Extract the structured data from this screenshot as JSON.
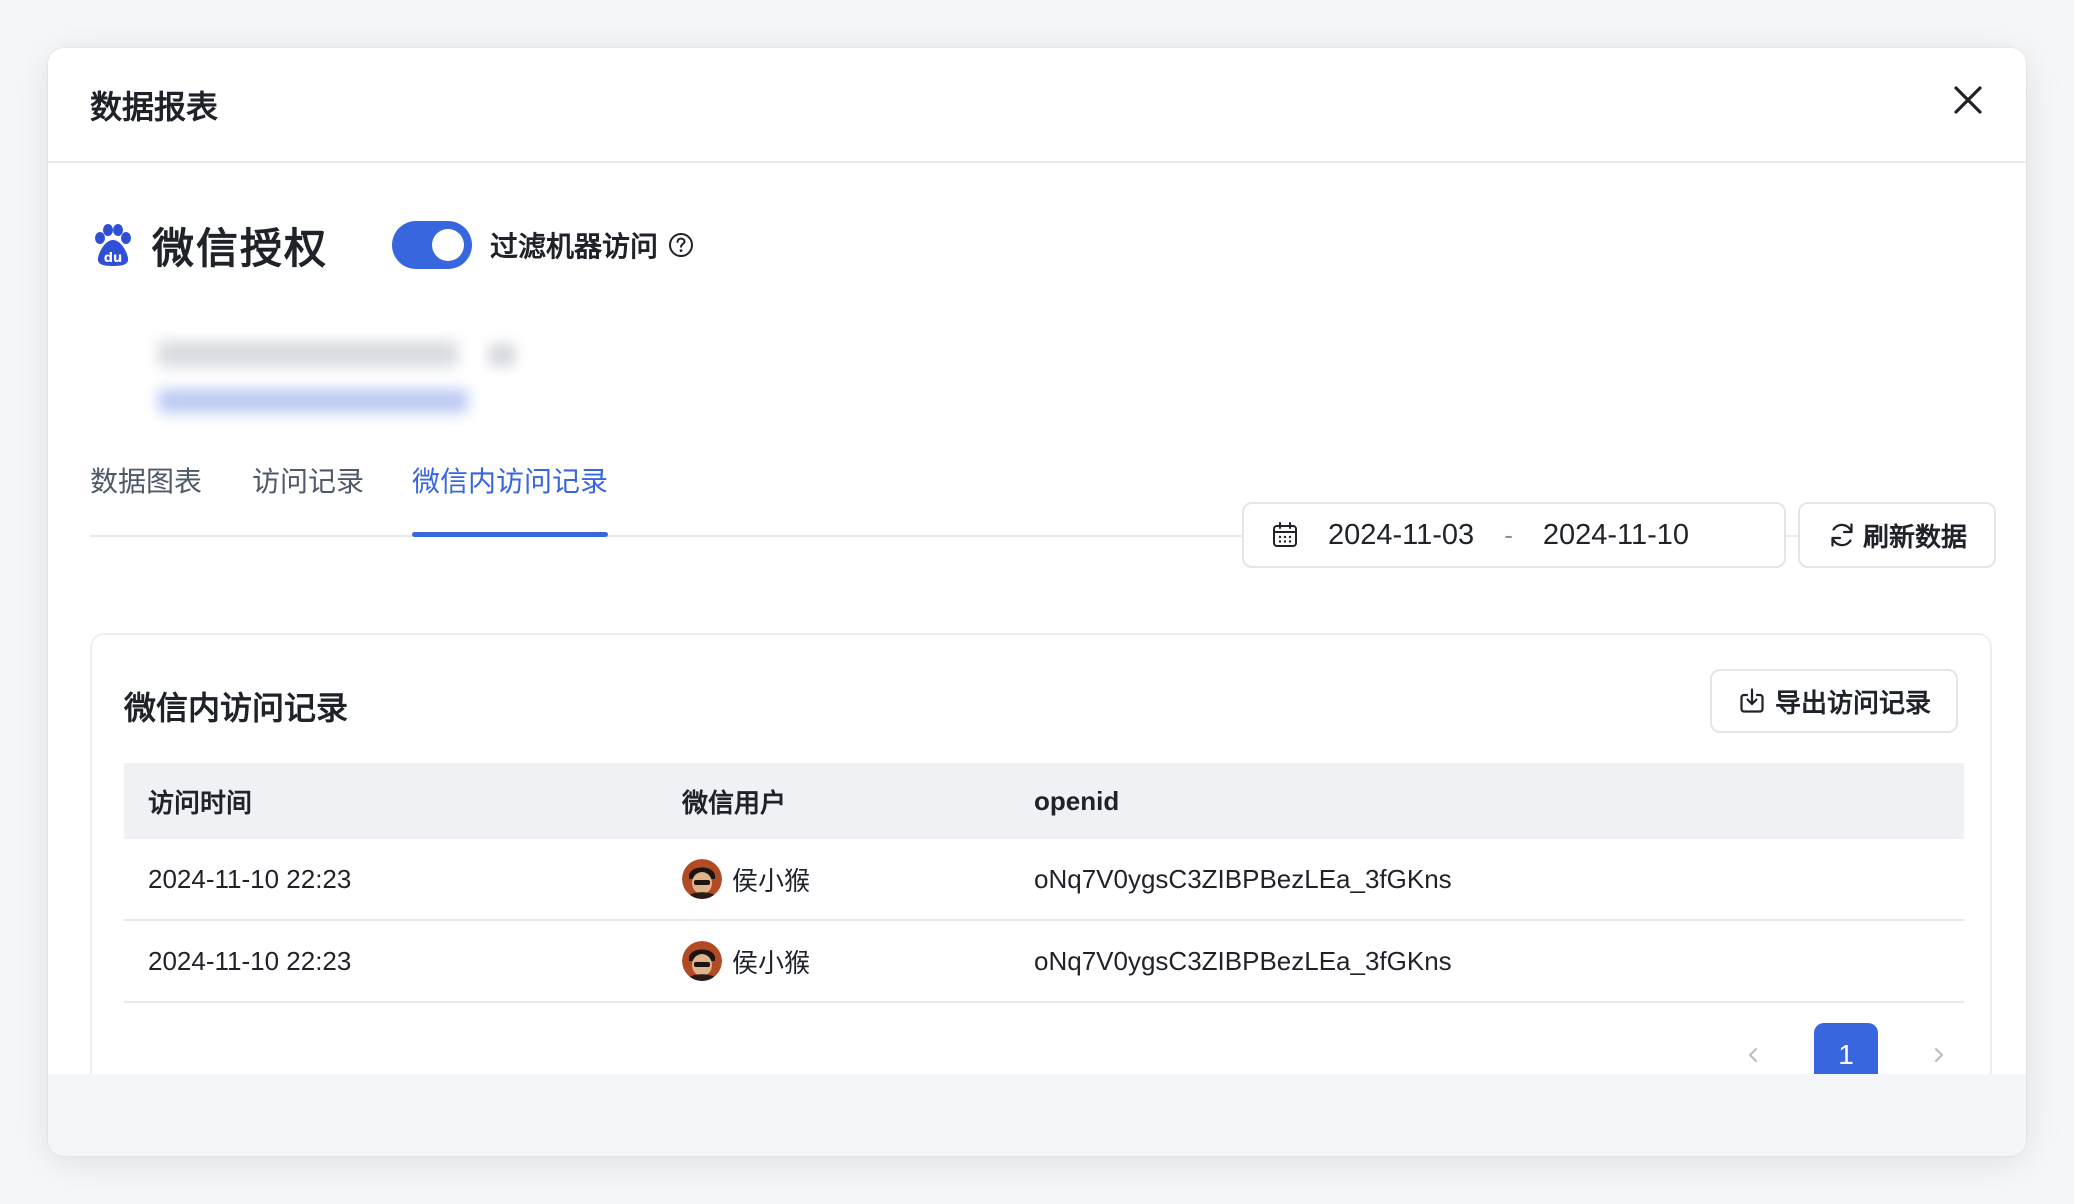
{
  "modal": {
    "title": "数据报表"
  },
  "app": {
    "name": "微信授权",
    "toggle_label": "过滤机器访问",
    "toggle_on": true
  },
  "tabs": [
    {
      "label": "数据图表",
      "active": false
    },
    {
      "label": "访问记录",
      "active": false
    },
    {
      "label": "微信内访问记录",
      "active": true
    }
  ],
  "date_range": {
    "start": "2024-11-03",
    "separator": "-",
    "end": "2024-11-10"
  },
  "refresh_button": {
    "label": "刷新数据"
  },
  "card": {
    "title": "微信内访问记录",
    "export_label": "导出访问记录"
  },
  "table": {
    "columns": [
      "访问时间",
      "微信用户",
      "openid"
    ],
    "rows": [
      {
        "time": "2024-11-10 22:23",
        "user": "侯小猴",
        "openid": "oNq7V0ygsC3ZIBPBezLEa_3fGKns"
      },
      {
        "time": "2024-11-10 22:23",
        "user": "侯小猴",
        "openid": "oNq7V0ygsC3ZIBPBezLEa_3fGKns"
      }
    ]
  },
  "pagination": {
    "current_page": "1"
  },
  "colors": {
    "accent": "#3866de",
    "border": "#e8eaee",
    "table_header_bg": "#eff1f5"
  }
}
